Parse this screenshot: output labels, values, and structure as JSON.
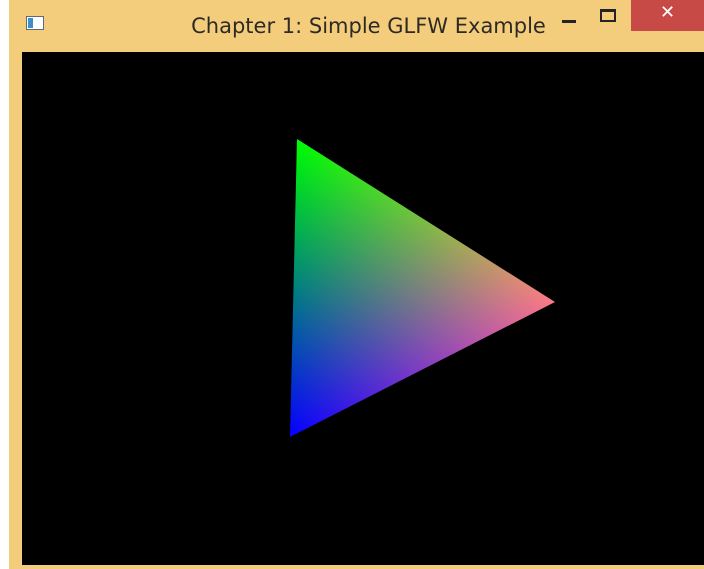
{
  "window": {
    "title": "Chapter 1: Simple GLFW Example",
    "frame_color": "#f3cd7b",
    "close_button_color": "#c74a46",
    "clear_color": "#000000",
    "icons": {
      "app": "app-window-icon",
      "minimize": "minimize-icon",
      "maximize": "maximize-icon",
      "close": "close-icon"
    },
    "close_glyph": "✕"
  },
  "scene": {
    "shape": "triangle",
    "vertex_colors": {
      "top": "#00ff00",
      "right": "#ff0000",
      "bottom": "#0000ff"
    }
  }
}
